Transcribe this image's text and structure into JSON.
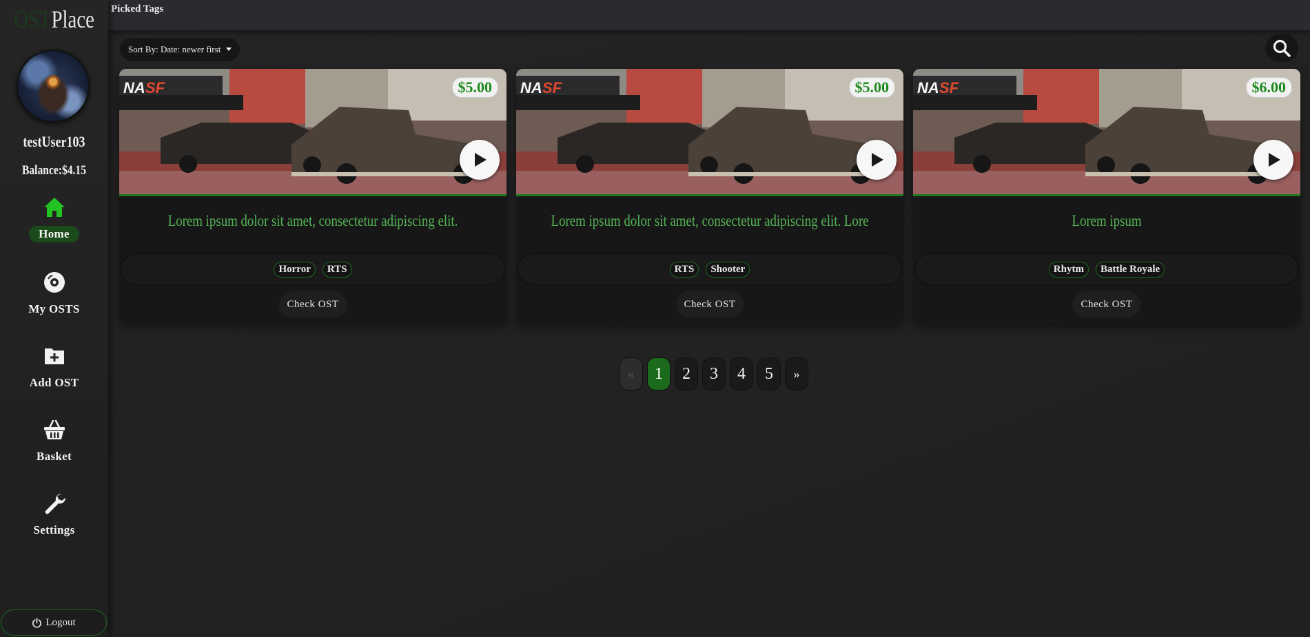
{
  "brand": {
    "prefix": "OST",
    "name": "Place"
  },
  "user": {
    "name": "testUser103",
    "balance": "Balance:$4.15"
  },
  "nav": {
    "home": "Home",
    "my_osts": "My OSTS",
    "add_ost": "Add OST",
    "basket": "Basket",
    "settings": "Settings",
    "logout": "Logout"
  },
  "topbar": {
    "title": "Picked Tags"
  },
  "toolbar": {
    "sort_label": "Sort By: Date: newer first"
  },
  "cards": [
    {
      "price": "$5.00",
      "title": "Lorem ipsum dolor sit amet, consectetur adipiscing elit.",
      "tags": [
        "Horror",
        "RTS"
      ],
      "button": "Check OST"
    },
    {
      "price": "$5.00",
      "title": "Lorem ipsum dolor sit amet, consectetur adipiscing elit. Lorem i",
      "tags": [
        "RTS",
        "Shooter"
      ],
      "button": "Check OST"
    },
    {
      "price": "$6.00",
      "title": "Lorem ipsum",
      "tags": [
        "Rhytm",
        "Battle Royale"
      ],
      "button": "Check OST"
    }
  ],
  "pagination": {
    "prev": "«",
    "pages": [
      "1",
      "2",
      "3",
      "4",
      "5"
    ],
    "next": "»",
    "current": "1"
  },
  "colors": {
    "accent": "#1c6b1c",
    "title_green": "#54b354",
    "home_icon": "#22c322"
  },
  "icons": {
    "home": "home-icon",
    "my_osts": "disc-icon",
    "add_ost": "folder-plus-icon",
    "basket": "basket-icon",
    "settings": "wrench-icon",
    "logout": "power-icon",
    "search": "search-icon",
    "play": "play-icon"
  }
}
